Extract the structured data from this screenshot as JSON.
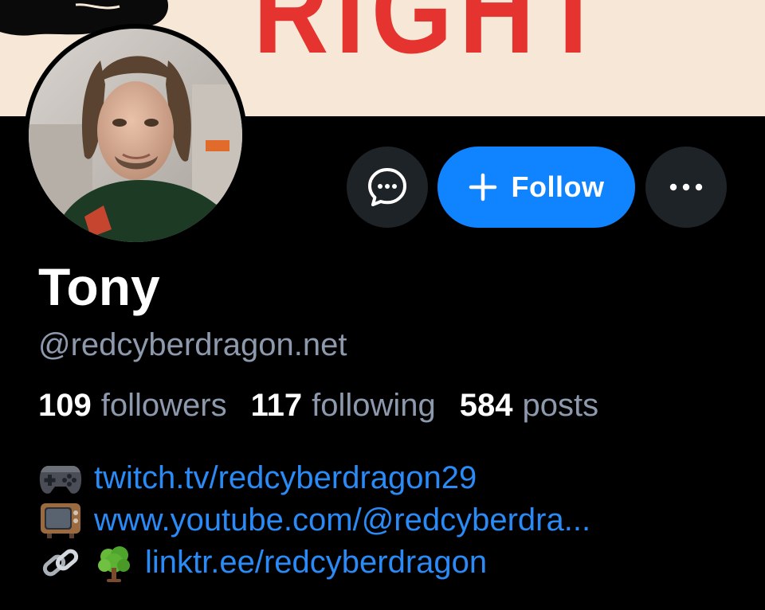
{
  "banner": {
    "text": "RIGHT"
  },
  "profile": {
    "display_name": "Tony",
    "handle": "@redcyberdragon.net"
  },
  "actions": {
    "follow_label": "Follow"
  },
  "stats": {
    "followers_count": "109",
    "followers_label": "followers",
    "following_count": "117",
    "following_label": "following",
    "posts_count": "584",
    "posts_label": "posts"
  },
  "bio": {
    "links": [
      {
        "emoji": "video-game-emoji",
        "text": "twitch.tv/redcyberdragon29"
      },
      {
        "emoji": "television-emoji",
        "text": "www.youtube.com/@redcyberdra..."
      },
      {
        "emoji": "link-and-tree-emoji",
        "text": "linktr.ee/redcyberdragon"
      }
    ]
  },
  "colors": {
    "background": "#000000",
    "accent": "#1083fe",
    "link": "#2a8af6",
    "muted_text": "#8d99ac",
    "button_dark": "#1e2328",
    "banner_bg": "#f7e7d6",
    "banner_text": "#e53430"
  },
  "icons": {
    "message": "chat-bubble-dots-icon",
    "follow": "plus-icon",
    "more": "ellipsis-icon"
  }
}
